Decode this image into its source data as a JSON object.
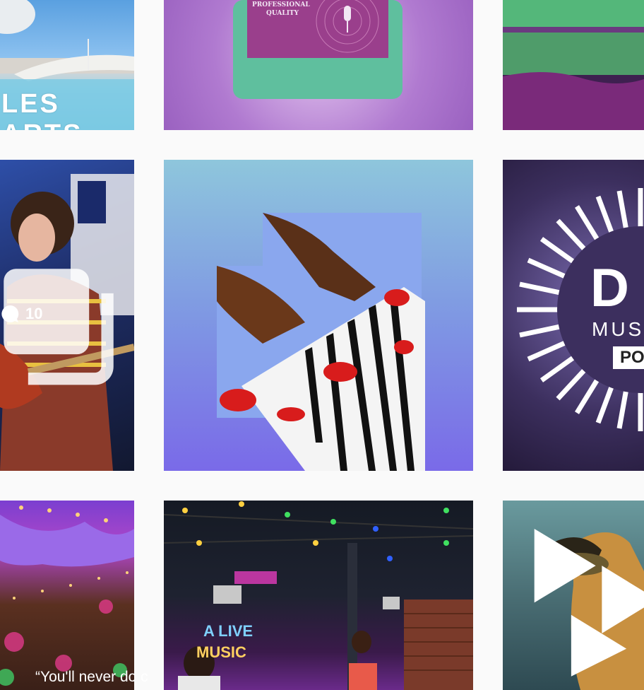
{
  "grid": {
    "posts": [
      {
        "id": "post-1",
        "overlay_text": "LES ARTS"
      },
      {
        "id": "post-2",
        "label_line1": "PROFESSIONAL",
        "label_line2": "QUALITY"
      },
      {
        "id": "post-3"
      },
      {
        "id": "post-4",
        "is_carousel": true,
        "comments": "10"
      },
      {
        "id": "post-5"
      },
      {
        "id": "post-6",
        "letter": "D",
        "word": "MUS",
        "tag": "PO"
      },
      {
        "id": "post-7"
      },
      {
        "id": "post-8",
        "sign_line1": "A LIVE",
        "sign_line2": "MUSIC"
      },
      {
        "id": "post-9",
        "quote": "“You'll never do c"
      }
    ]
  },
  "colors": {
    "page_bg": "#fafafa",
    "overlay_text": "#ffffff"
  },
  "icons": {
    "carousel": "carousel-icon",
    "comment": "comment-bubble-icon",
    "play_logo": "play-logo-icon"
  }
}
